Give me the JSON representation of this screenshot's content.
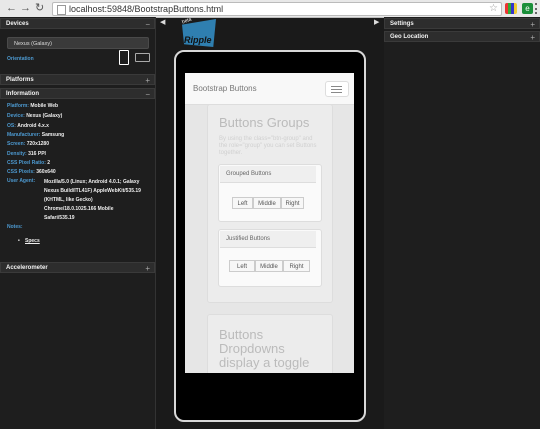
{
  "browser": {
    "url": "localhost:59848/BootstrapButtons.html"
  },
  "left_panel": {
    "devices": {
      "title": "Devices",
      "selected_device": "Nexus (Galaxy)",
      "orientation_label": "Orientation"
    },
    "platforms": {
      "title": "Platforms"
    },
    "information": {
      "title": "Information",
      "rows": [
        {
          "label": "Platform:",
          "value": "Mobile Web"
        },
        {
          "label": "Device:",
          "value": "Nexus (Galaxy)"
        },
        {
          "label": "OS:",
          "value": "Android 4.x.x"
        },
        {
          "label": "Manufacturer:",
          "value": "Samsung"
        },
        {
          "label": "Screen:",
          "value": "720x1280"
        },
        {
          "label": "Density:",
          "value": "316 PPI"
        },
        {
          "label": "CSS Pixel Ratio:",
          "value": "2"
        },
        {
          "label": "CSS Pixels:",
          "value": "360x640"
        }
      ],
      "user_agent_label": "User Agent:",
      "user_agent_lines": [
        "Mozilla/5.0 (Linux; Android 4.0.1; Galaxy",
        "Nexus Build/ITL41F) AppleWebKit/535.19",
        "(KHTML, like Gecko)",
        "Chrome/18.0.1025.166 Mobile",
        "Safari/535.19"
      ],
      "notes_label": "Notes:",
      "specs_link": "Specs"
    },
    "accelerometer": {
      "title": "Accelerometer"
    }
  },
  "right_panel": {
    "settings": {
      "title": "Settings"
    },
    "geo_location": {
      "title": "Geo Location"
    }
  },
  "logo": {
    "beta": "beta",
    "name": "Ripple"
  },
  "device_screen": {
    "navbar_title": "Bootstrap Buttons",
    "section1": {
      "heading": "Buttons Groups",
      "description": "By using the class=\"btn-group\" and the role=\"group\" you can set Buttons together.",
      "grouped": {
        "title": "Grouped Buttons",
        "buttons": [
          "Left",
          "Middle",
          "Right"
        ]
      },
      "justified": {
        "title": "Justified Buttons",
        "buttons": [
          "Left",
          "Middle",
          "Right"
        ]
      }
    },
    "section2": {
      "heading_lines": [
        "Buttons",
        "Dropdowns",
        "display a toggle"
      ]
    }
  }
}
